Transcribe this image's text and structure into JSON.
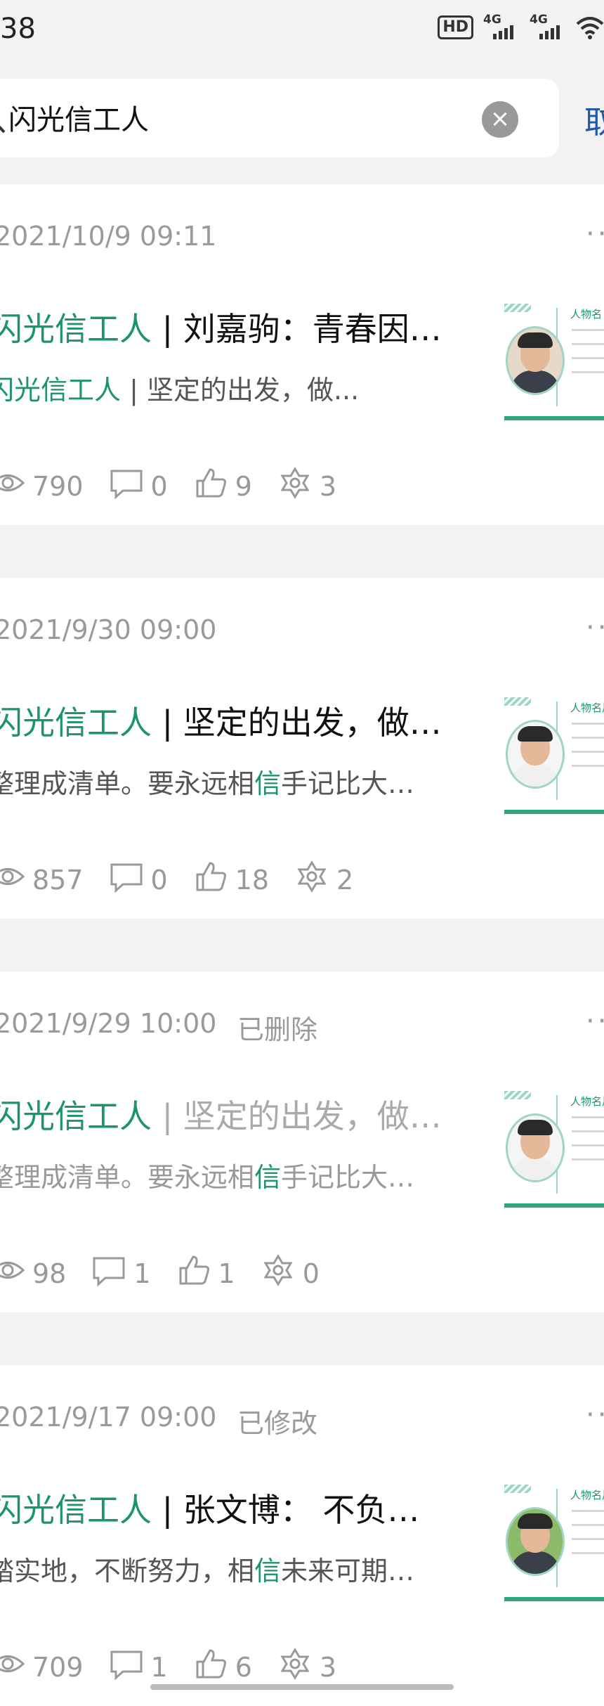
{
  "status_bar": {
    "time": "38",
    "hd_label": "HD",
    "signal_labels": [
      "4G",
      "4G"
    ]
  },
  "search": {
    "query": "闪光信工人",
    "cancel_label": "取"
  },
  "posts": [
    {
      "date": "2021/10/9 09:11",
      "badge": "",
      "title_highlight": "闪光信工人",
      "title_rest": " | 刘嘉驹：青春因…",
      "desc_pre": "",
      "desc_hl": "闪光信工人",
      "desc_post": " | 坚定的出发，做...",
      "views": "790",
      "comments": "0",
      "likes": "9",
      "shares": "3",
      "thumb_title": "人物名"
    },
    {
      "date": "2021/9/30 09:00",
      "badge": "",
      "title_highlight": "闪光信工人",
      "title_rest": " | 坚定的出发，做…",
      "desc_pre": "整理成清单。要永远相",
      "desc_hl": "信",
      "desc_post": "手记比大…",
      "views": "857",
      "comments": "0",
      "likes": "18",
      "shares": "2",
      "thumb_title": "人物名片"
    },
    {
      "date": "2021/9/29 10:00",
      "badge": "已删除",
      "title_highlight": "闪光信工人",
      "title_rest": " | 坚定的出发，做…",
      "desc_pre": "整理成清单。要永远相",
      "desc_hl": "信",
      "desc_post": "手记比大…",
      "views": "98",
      "comments": "1",
      "likes": "1",
      "shares": "0",
      "thumb_title": "人物名片"
    },
    {
      "date": "2021/9/17 09:00",
      "badge": "已修改",
      "title_highlight": "闪光信工人",
      "title_rest": " | 张文博： 不负…",
      "desc_pre": "踏实地，不断努力，相",
      "desc_hl": "信",
      "desc_post": "未来可期…",
      "views": "709",
      "comments": "1",
      "likes": "6",
      "shares": "3",
      "thumb_title": "人物名片"
    }
  ]
}
